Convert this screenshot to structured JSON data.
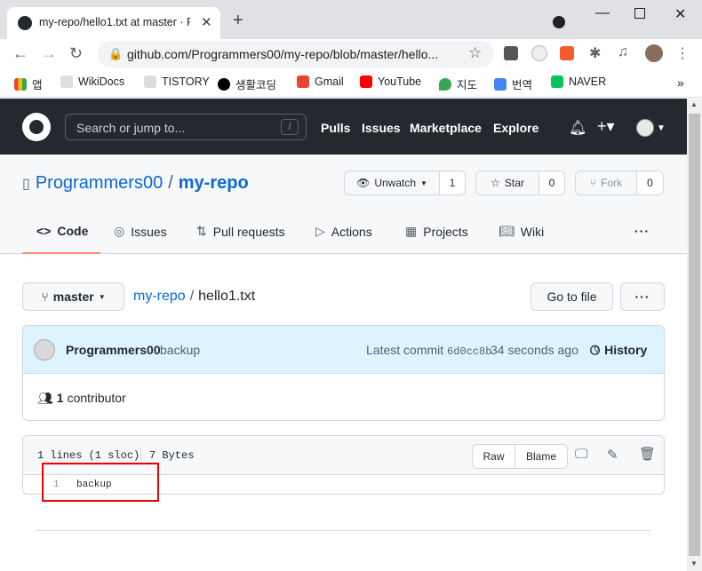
{
  "browser": {
    "tab_title": "my-repo/hello1.txt at master · P",
    "url": "github.com/Programmers00/my-repo/blob/master/hello...",
    "bookmarks": [
      "앱",
      "WikiDocs",
      "TISTORY",
      "생활코딩",
      "Gmail",
      "YouTube",
      "지도",
      "번역",
      "NAVER"
    ],
    "overflow": "»"
  },
  "github": {
    "search_placeholder": "Search or jump to...",
    "search_shortcut": "/",
    "nav": [
      "Pulls",
      "Issues",
      "Marketplace",
      "Explore"
    ]
  },
  "repo": {
    "owner": "Programmers00",
    "separator": "/",
    "name": "my-repo",
    "unwatch_label": "Unwatch",
    "unwatch_count": "1",
    "star_label": "Star",
    "star_count": "0",
    "fork_label": "Fork",
    "fork_count": "0",
    "tabs": [
      "Code",
      "Issues",
      "Pull requests",
      "Actions",
      "Projects",
      "Wiki"
    ],
    "more": "···"
  },
  "file": {
    "branch": "master",
    "breadcrumb_repo": "my-repo",
    "breadcrumb_sep": "/",
    "filename": "hello1.txt",
    "go_to_file": "Go to file",
    "more": "···"
  },
  "commit": {
    "author": "Programmers00",
    "message": "backup",
    "latest_label": "Latest commit",
    "sha": "6d0cc8b",
    "time": "34 seconds ago",
    "history": "History",
    "contributors_count": "1",
    "contributors_label": "contributor"
  },
  "blob": {
    "lines_info": "1 lines (1 sloc)",
    "size": "7 Bytes",
    "raw": "Raw",
    "blame": "Blame",
    "line_number": "1",
    "line_content": "backup"
  }
}
